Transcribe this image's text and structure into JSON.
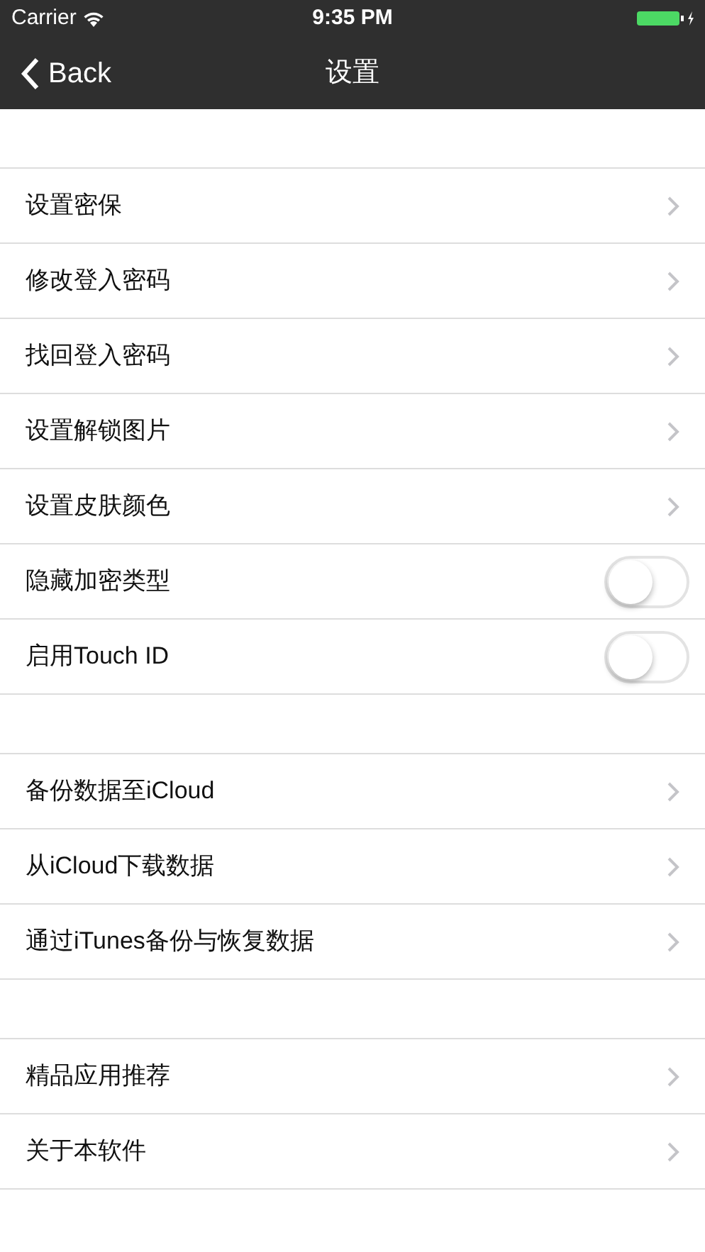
{
  "status_bar": {
    "carrier": "Carrier",
    "time": "9:35 PM",
    "battery_charging": true
  },
  "nav_bar": {
    "back": "Back",
    "title": "设置"
  },
  "sections": [
    {
      "rows": [
        {
          "label": "设置密保",
          "kind": "link"
        },
        {
          "label": "修改登入密码",
          "kind": "link"
        },
        {
          "label": "找回登入密码",
          "kind": "link"
        },
        {
          "label": "设置解锁图片",
          "kind": "link"
        },
        {
          "label": "设置皮肤颜色",
          "kind": "link"
        },
        {
          "label": "隐藏加密类型",
          "kind": "switch",
          "on": false
        },
        {
          "label": "启用Touch ID",
          "kind": "switch",
          "on": false
        }
      ]
    },
    {
      "rows": [
        {
          "label": "备份数据至iCloud",
          "kind": "link"
        },
        {
          "label": "从iCloud下载数据",
          "kind": "link"
        },
        {
          "label": "通过iTunes备份与恢复数据",
          "kind": "link"
        }
      ]
    },
    {
      "rows": [
        {
          "label": "精品应用推荐",
          "kind": "link"
        },
        {
          "label": "关于本软件",
          "kind": "link"
        }
      ]
    }
  ]
}
